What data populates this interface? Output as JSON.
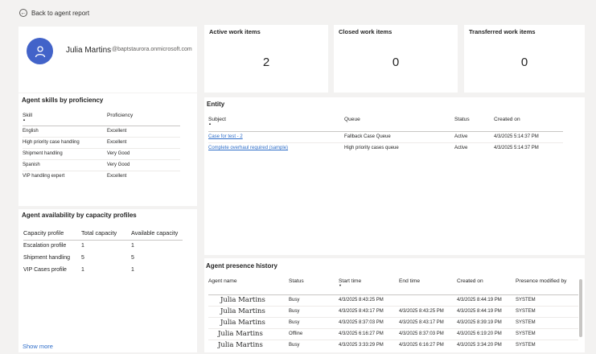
{
  "nav": {
    "back_label": "Back to agent report"
  },
  "profile": {
    "name": "Julia Martins",
    "email": "@baptstaurora.onmicrosoft.com"
  },
  "metrics": [
    {
      "title": "Active work items",
      "value": "2"
    },
    {
      "title": "Closed work items",
      "value": "0"
    },
    {
      "title": "Transferred work items",
      "value": "0"
    }
  ],
  "skills": {
    "title": "Agent skills by proficiency",
    "headers": [
      "Skill",
      "Proficiency"
    ],
    "rows": [
      [
        "English",
        "Excellent"
      ],
      [
        "High priority case handling",
        "Excellent"
      ],
      [
        "Shipment handling",
        "Very Good"
      ],
      [
        "Spanish",
        "Very Good"
      ],
      [
        "VIP handling expert",
        "Excellent"
      ]
    ]
  },
  "capacity": {
    "title": "Agent availability by capacity profiles",
    "headers": [
      "Capacity profile",
      "Total capacity",
      "Available capacity"
    ],
    "rows": [
      [
        "Escalation profile",
        "1",
        "1"
      ],
      [
        "Shipment handling",
        "5",
        "5"
      ],
      [
        "VIP Cases profile",
        "1",
        "1"
      ]
    ],
    "show_more": "Show more"
  },
  "entity": {
    "title": "Entity",
    "headers": [
      "Subject",
      "Queue",
      "Status",
      "Created on"
    ],
    "rows": [
      [
        "Case for test - 2",
        "Fallback Case Queue",
        "Active",
        "4/3/2025 5:14:37 PM"
      ],
      [
        "Complete overhaul required (sample)",
        "High priority cases queue",
        "Active",
        "4/3/2025 5:14:37 PM"
      ]
    ]
  },
  "presence": {
    "title": "Agent presence history",
    "headers": [
      "Agent name",
      "Status",
      "Start time",
      "End time",
      "Created on",
      "Presence modified by"
    ],
    "rows": [
      [
        "Julia Martins",
        "Busy",
        "4/3/2025 8:43:25 PM",
        "",
        "4/3/2025 8:44:19 PM",
        "SYSTEM"
      ],
      [
        "Julia Martins",
        "Busy",
        "4/3/2025 8:43:17 PM",
        "4/3/2025 8:43:25 PM",
        "4/3/2025 8:44:19 PM",
        "SYSTEM"
      ],
      [
        "Julia Martins",
        "Busy",
        "4/3/2025 8:37:03 PM",
        "4/3/2025 8:43:17 PM",
        "4/3/2025 8:39:19 PM",
        "SYSTEM"
      ],
      [
        "Julia Martins",
        "Offline",
        "4/3/2025 6:16:27 PM",
        "4/3/2025 8:37:03 PM",
        "4/3/2025 6:19:20 PM",
        "SYSTEM"
      ],
      [
        "Julia Martins",
        "Busy",
        "4/3/2025 3:33:29 PM",
        "4/3/2025 6:16:27 PM",
        "4/3/2025 3:34:20 PM",
        "SYSTEM"
      ]
    ]
  }
}
